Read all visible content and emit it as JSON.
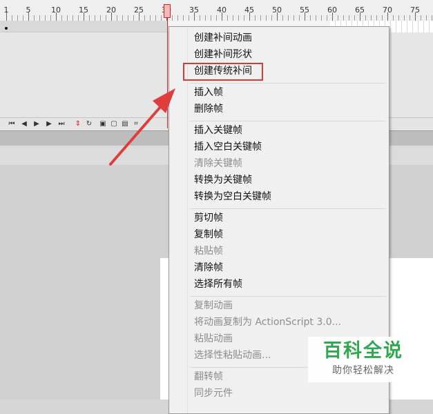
{
  "ruler": {
    "labels": [
      "1",
      "5",
      "10",
      "15",
      "20",
      "25",
      "30",
      "35",
      "40",
      "45",
      "50",
      "55",
      "60",
      "65",
      "70",
      "75"
    ]
  },
  "context_menu": {
    "groups": [
      [
        {
          "label": "创建补间动画",
          "enabled": true
        },
        {
          "label": "创建补间形状",
          "enabled": true
        },
        {
          "label": "创建传统补间",
          "enabled": true,
          "highlighted": true
        }
      ],
      [
        {
          "label": "插入帧",
          "enabled": true
        },
        {
          "label": "删除帧",
          "enabled": true
        }
      ],
      [
        {
          "label": "插入关键帧",
          "enabled": true
        },
        {
          "label": "插入空白关键帧",
          "enabled": true
        },
        {
          "label": "清除关键帧",
          "enabled": false
        },
        {
          "label": "转换为关键帧",
          "enabled": true
        },
        {
          "label": "转换为空白关键帧",
          "enabled": true
        }
      ],
      [
        {
          "label": "剪切帧",
          "enabled": true
        },
        {
          "label": "复制帧",
          "enabled": true
        },
        {
          "label": "粘贴帧",
          "enabled": false
        },
        {
          "label": "清除帧",
          "enabled": true
        },
        {
          "label": "选择所有帧",
          "enabled": true
        }
      ],
      [
        {
          "label": "复制动画",
          "enabled": false
        },
        {
          "label": "将动画复制为 ActionScript 3.0...",
          "enabled": false
        },
        {
          "label": "粘贴动画",
          "enabled": false
        },
        {
          "label": "选择性粘贴动画...",
          "enabled": false
        }
      ],
      [
        {
          "label": "翻转帧",
          "enabled": false
        },
        {
          "label": "同步元件",
          "enabled": false
        }
      ]
    ]
  },
  "watermark": {
    "title": "百科全说",
    "subtitle": "助你轻松解决"
  },
  "colors": {
    "highlight_box": "#d43a3a",
    "arrow": "#e03c3c",
    "playhead": "#d62020",
    "watermark_green": "#2fa84f"
  }
}
